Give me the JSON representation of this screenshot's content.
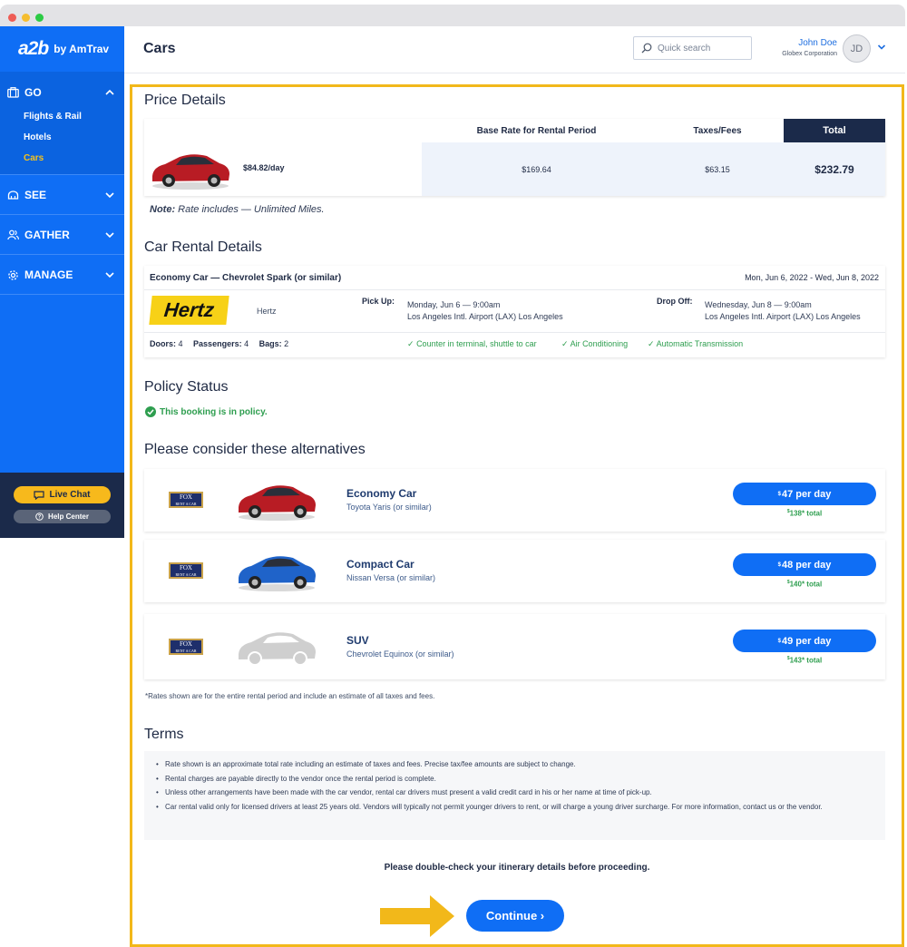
{
  "window": {
    "title": ""
  },
  "sidebar": {
    "logo": "a2b",
    "logo_by": "by AmTrav",
    "sections": [
      {
        "label": "GO",
        "items": [
          "Flights & Rail",
          "Hotels",
          "Cars"
        ]
      },
      {
        "label": "SEE"
      },
      {
        "label": "GATHER"
      },
      {
        "label": "MANAGE"
      }
    ],
    "live_chat": "Live Chat",
    "help_center": "Help Center"
  },
  "header": {
    "title": "Cars",
    "search_placeholder": "Quick search",
    "user_name": "John Doe",
    "user_org": "Globex Corporation",
    "avatar_initials": "JD"
  },
  "price": {
    "heading": "Price Details",
    "col_base": "Base Rate for Rental Period",
    "col_taxes": "Taxes/Fees",
    "col_total": "Total",
    "daily": "$84.82/day",
    "base": "$169.64",
    "taxes": "$63.15",
    "total": "$232.79",
    "note_label": "Note:",
    "note_text": " Rate includes — Unlimited Miles."
  },
  "rental": {
    "heading": "Car Rental Details",
    "car_title": "Economy Car — Chevrolet Spark (or similar)",
    "date_range": "Mon, Jun 6, 2022 - Wed, Jun 8, 2022",
    "vendor_logo": "Hertz",
    "vendor": "Hertz",
    "pickup_label": "Pick Up:",
    "pickup_time": "Monday, Jun 6 — 9:00am",
    "pickup_loc": "Los Angeles Intl. Airport (LAX) Los Angeles",
    "dropoff_label": "Drop Off:",
    "dropoff_time": "Wednesday, Jun 8 — 9:00am",
    "dropoff_loc": "Los Angeles Intl. Airport (LAX) Los Angeles",
    "doors_label": "Doors:",
    "doors": "4",
    "passengers_label": "Passengers:",
    "passengers": "4",
    "bags_label": "Bags:",
    "bags": "2",
    "features": [
      "Counter in terminal, shuttle to car",
      "Air Conditioning",
      "Automatic Transmission"
    ]
  },
  "policy": {
    "heading": "Policy Status",
    "status": "This booking is in policy."
  },
  "alternatives": {
    "heading": "Please consider these alternatives",
    "vendor_logo_line1": "FOX",
    "vendor_logo_line2": "RENT A CAR",
    "items": [
      {
        "name": "Economy Car",
        "model": "Toyota Yaris (or similar)",
        "currency": "$",
        "per_day": "47 per day",
        "total": "138* total",
        "car_color": "#b81c24"
      },
      {
        "name": "Compact Car",
        "model": "Nissan Versa (or similar)",
        "currency": "$",
        "per_day": "48 per day",
        "total": "140* total",
        "car_color": "#1f63c9"
      },
      {
        "name": "SUV",
        "model": "Chevrolet Equinox (or similar)",
        "currency": "$",
        "per_day": "49 per day",
        "total": "143* total",
        "car_color": "#c8c8c8"
      }
    ],
    "footnote": "*Rates shown are for the entire rental period and include an estimate of all taxes and fees."
  },
  "terms": {
    "heading": "Terms",
    "items": [
      "Rate shown is an approximate total rate including an estimate of taxes and fees. Precise tax/fee amounts are subject to change.",
      "Rental charges are payable directly to the vendor once the rental period is complete.",
      "Unless other arrangements have been made with the car vendor, rental car drivers must present a valid credit card in his or her name at time of pick-up.",
      "Car rental valid only for licensed drivers at least 25 years old. Vendors will typically not permit younger drivers to rent, or will charge a young driver surcharge. For more information, contact us or the vendor."
    ]
  },
  "footer": {
    "check_text": "Please double-check your itinerary details before proceeding.",
    "continue": "Continue ›"
  },
  "colors": {
    "brand_blue": "#0f6ef5",
    "accent_yellow": "#f2b81a",
    "navy": "#1b2a4a",
    "green": "#2e9e4f"
  }
}
